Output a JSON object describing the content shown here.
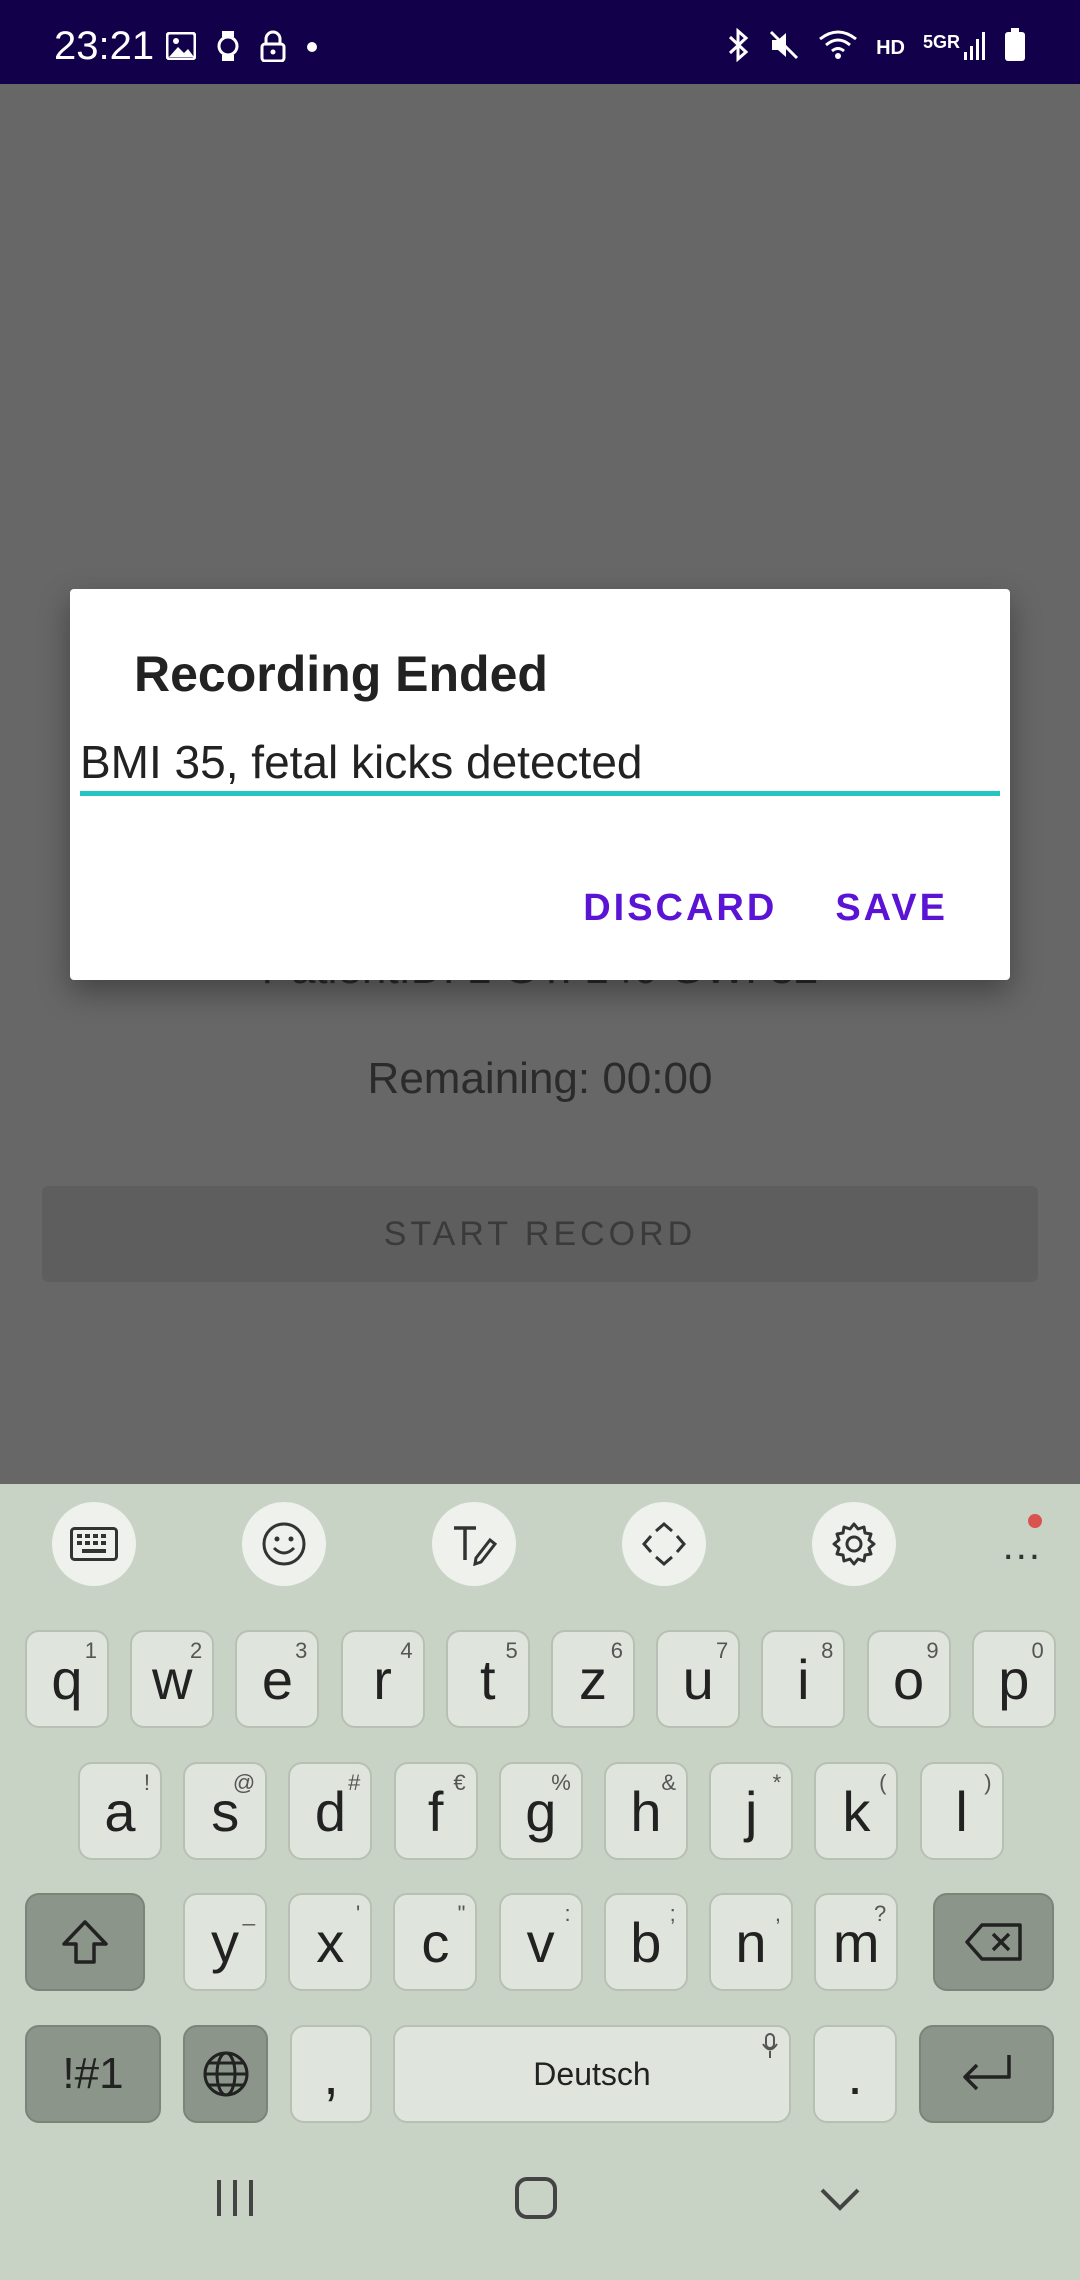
{
  "status_bar": {
    "time": "23:21",
    "left_icons": [
      "image-icon",
      "watch-icon",
      "lock-icon",
      "dot-icon"
    ],
    "right_icons": [
      "bluetooth-icon",
      "mute-icon",
      "wifi-icon",
      "signal-icon",
      "battery-icon"
    ],
    "hd": "HD",
    "network": "5GR"
  },
  "background": {
    "patient_info": "PatientID: 1   GT: 140   GW: 32",
    "remaining": "Remaining: 00:00",
    "start_button": "START RECORD"
  },
  "dialog": {
    "title": "Recording Ended",
    "input_value": "BMI 35, fetal kicks detected",
    "discard_label": "DISCARD",
    "save_label": "SAVE",
    "accent_color": "#5b14d6",
    "underline_color": "#26c6c0"
  },
  "keyboard": {
    "toolbar": [
      "keyboard-icon",
      "emoji-icon",
      "handwriting-icon",
      "move-icon",
      "settings-icon",
      "more-icon"
    ],
    "more_label": "...",
    "row1": [
      {
        "k": "q",
        "s": "1"
      },
      {
        "k": "w",
        "s": "2"
      },
      {
        "k": "e",
        "s": "3"
      },
      {
        "k": "r",
        "s": "4"
      },
      {
        "k": "t",
        "s": "5"
      },
      {
        "k": "z",
        "s": "6"
      },
      {
        "k": "u",
        "s": "7"
      },
      {
        "k": "i",
        "s": "8"
      },
      {
        "k": "o",
        "s": "9"
      },
      {
        "k": "p",
        "s": "0"
      }
    ],
    "row2": [
      {
        "k": "a",
        "s": "!"
      },
      {
        "k": "s",
        "s": "@"
      },
      {
        "k": "d",
        "s": "#"
      },
      {
        "k": "f",
        "s": "€"
      },
      {
        "k": "g",
        "s": "%"
      },
      {
        "k": "h",
        "s": "&"
      },
      {
        "k": "j",
        "s": "*"
      },
      {
        "k": "k",
        "s": "("
      },
      {
        "k": "l",
        "s": ")"
      }
    ],
    "row3": [
      {
        "k": "y",
        "s": "_"
      },
      {
        "k": "x",
        "s": "'"
      },
      {
        "k": "c",
        "s": "\""
      },
      {
        "k": "v",
        "s": ":"
      },
      {
        "k": "b",
        "s": ";"
      },
      {
        "k": "n",
        "s": ","
      },
      {
        "k": "m",
        "s": "?"
      }
    ],
    "symbols_label": "!#1",
    "comma_label": ",",
    "space_label": "Deutsch",
    "period_label": "."
  },
  "navbar": {
    "icons": [
      "recent-apps-icon",
      "home-icon",
      "back-icon"
    ]
  }
}
